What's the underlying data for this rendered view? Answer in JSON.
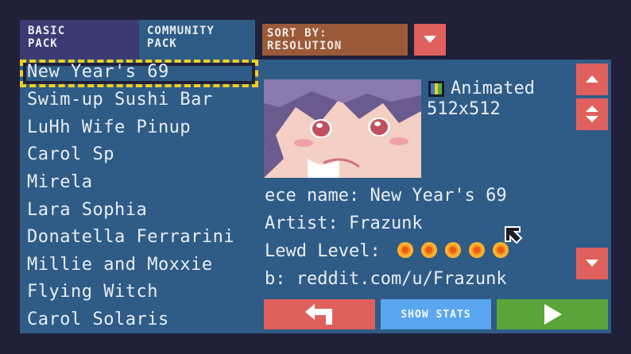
{
  "tabs": {
    "basic": "BASIC\nPACK",
    "community": "COMMUNITY\nPACK"
  },
  "sort": {
    "label": "SORT BY:\nRESOLUTION"
  },
  "list": {
    "items": [
      "New Year's 69",
      "Swim-up Sushi Bar",
      "LuHh Wife Pinup",
      "Carol Sp",
      "Mirela",
      "Lara Sophia",
      "Donatella Ferrarini",
      "Millie and Moxxie",
      "Flying Witch",
      "Carol Solaris"
    ]
  },
  "detail": {
    "type": "Animated",
    "resolution": "512x512",
    "piece_name": "ece name: New Year's 69",
    "artist": "Artist: Frazunk",
    "lewd_label": "Lewd Level:",
    "lewd_level": 5,
    "web": "b: reddit.com/u/Frazunk"
  },
  "buttons": {
    "show_stats": "SHOW STATS"
  },
  "colors": {
    "panel": "#2f5c86",
    "background": "#202038",
    "red": "#e0605e",
    "green": "#5aa43a",
    "blue": "#5aa6f0",
    "selection": "#f0d020"
  }
}
